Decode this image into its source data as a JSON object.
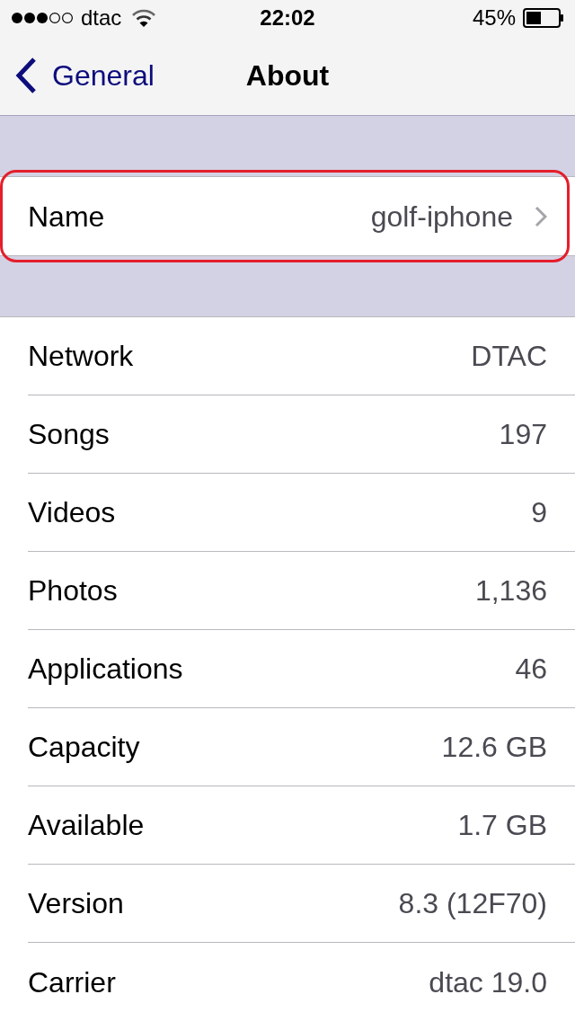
{
  "status_bar": {
    "carrier": "dtac",
    "time": "22:02",
    "battery": "45%"
  },
  "nav_bar": {
    "back": "General",
    "title": "About"
  },
  "name_row": {
    "label": "Name",
    "value": "golf-iphone",
    "highlighted": true
  },
  "info_rows": [
    {
      "label": "Network",
      "value": "DTAC"
    },
    {
      "label": "Songs",
      "value": "197"
    },
    {
      "label": "Videos",
      "value": "9"
    },
    {
      "label": "Photos",
      "value": "1,136"
    },
    {
      "label": "Applications",
      "value": "46"
    },
    {
      "label": "Capacity",
      "value": "12.6 GB"
    },
    {
      "label": "Available",
      "value": "1.7 GB"
    },
    {
      "label": "Version",
      "value": "8.3 (12F70)"
    },
    {
      "label": "Carrier",
      "value": "dtac 19.0"
    }
  ]
}
